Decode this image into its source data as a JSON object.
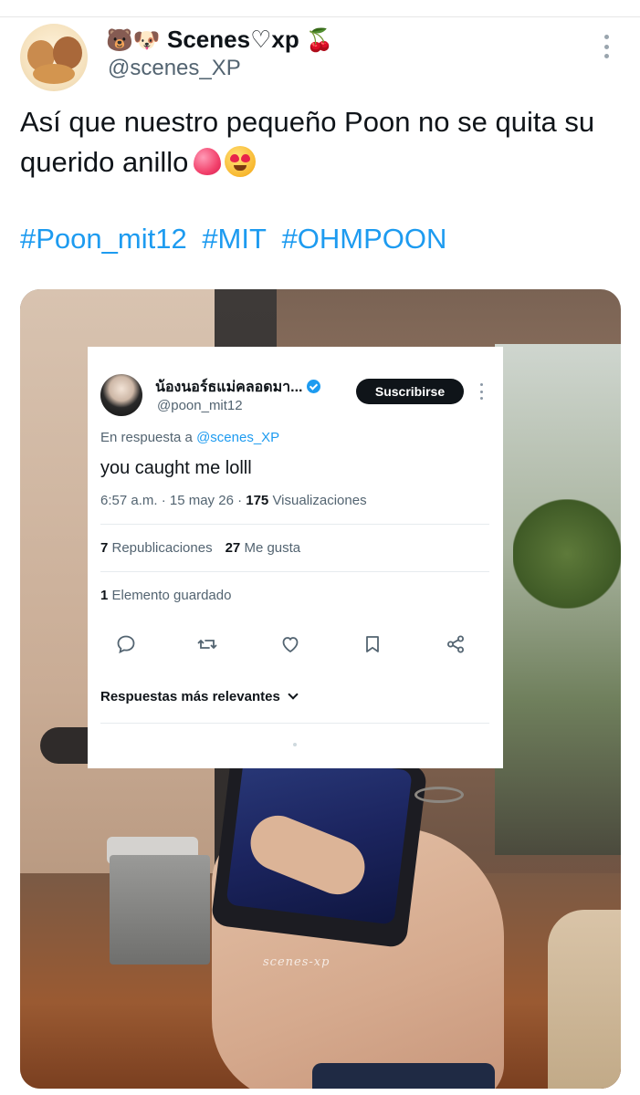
{
  "header": {
    "display_name": "Scenes♡xp",
    "name_prefix_emojis": "🐻🐶",
    "name_suffix_emoji": "🍒",
    "handle": "@scenes_XP",
    "avatar_icon": "teddy-bear-puppy-avatar"
  },
  "tweet": {
    "text": "Así que nuestro pequeño Poon no se quita su querido anillo",
    "hashtags": [
      "#Poon_mit12",
      "#MIT",
      "#OHMPOON"
    ]
  },
  "embedded": {
    "author_name": "น้องนอร์ธแม่คลอดมา...",
    "author_handle": "@poon_mit12",
    "subscribe_label": "Suscribirse",
    "reply_prefix": "En respuesta a",
    "reply_mention": "@scenes_XP",
    "text": "you caught me lolll",
    "meta_time": "6:57 a.m. · 15 may 26 · ",
    "meta_views": "175",
    "meta_views_label": " Visualizaciones",
    "reposts_count": "7",
    "reposts_label": " Republicaciones",
    "likes_count": "27",
    "likes_label": " Me gusta",
    "saved_count": "1",
    "saved_label": " Elemento guardado",
    "sort_label": "Respuestas más relevantes"
  },
  "watermark": "scenes-xp",
  "colors": {
    "accent": "#1d9bf0",
    "text": "#0f1419",
    "muted": "#536471"
  }
}
